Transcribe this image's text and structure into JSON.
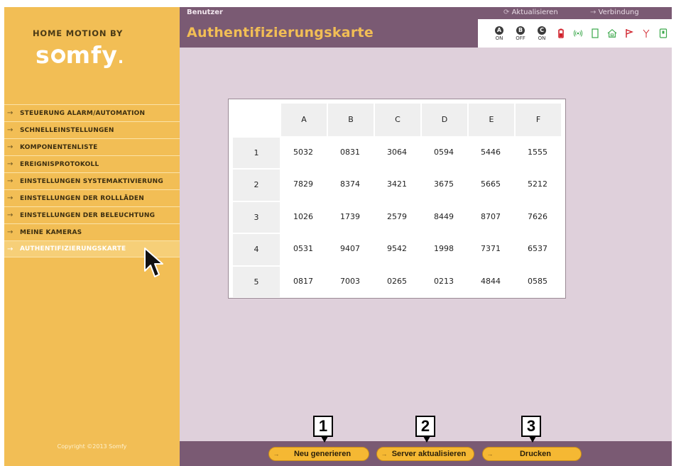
{
  "brand": {
    "top_text": "HOME MOTION BY",
    "logo_text": "somfy."
  },
  "sidebar": {
    "items": [
      {
        "label": "STEUERUNG ALARM/AUTOMATION"
      },
      {
        "label": "SCHNELLEINSTELLUNGEN"
      },
      {
        "label": "KOMPONENTENLISTE"
      },
      {
        "label": "EREIGNISPROTOKOLL"
      },
      {
        "label": "EINSTELLUNGEN SYSTEMAKTIVIERUNG"
      },
      {
        "label": "EINSTELLUNGEN DER ROLLLÄDEN"
      },
      {
        "label": "EINSTELLUNGEN DER BELEUCHTUNG"
      },
      {
        "label": "MEINE KAMERAS"
      },
      {
        "label": "AUTHENTIFIZIERUNGSKARTE",
        "active": true
      }
    ],
    "copyright": "Copyright ©2013 Somfy"
  },
  "header": {
    "user_label": "Benutzer",
    "refresh_link": "Aktualisieren",
    "connection_link": "Verbindung",
    "title": "Authentifizierungskarte",
    "modes": [
      {
        "letter": "A",
        "state": "ON"
      },
      {
        "letter": "B",
        "state": "OFF"
      },
      {
        "letter": "C",
        "state": "ON"
      }
    ],
    "status_icons": [
      "battery-icon",
      "radio-signal-icon",
      "door-icon",
      "home-icon",
      "flag-icon",
      "antenna-icon",
      "device-icon"
    ]
  },
  "auth_card": {
    "columns": [
      "A",
      "B",
      "C",
      "D",
      "E",
      "F"
    ],
    "rows": [
      {
        "label": "1",
        "values": [
          "5032",
          "0831",
          "3064",
          "0594",
          "5446",
          "1555"
        ]
      },
      {
        "label": "2",
        "values": [
          "7829",
          "8374",
          "3421",
          "3675",
          "5665",
          "5212"
        ]
      },
      {
        "label": "3",
        "values": [
          "1026",
          "1739",
          "2579",
          "8449",
          "8707",
          "7626"
        ]
      },
      {
        "label": "4",
        "values": [
          "0531",
          "9407",
          "9542",
          "1998",
          "7371",
          "6537"
        ]
      },
      {
        "label": "5",
        "values": [
          "0817",
          "7003",
          "0265",
          "0213",
          "4844",
          "0585"
        ]
      }
    ]
  },
  "footer": {
    "buttons": [
      {
        "label": "Neu generieren"
      },
      {
        "label": "Server aktualisieren"
      },
      {
        "label": "Drucken"
      }
    ]
  },
  "callouts": [
    "1",
    "2",
    "3"
  ],
  "colors": {
    "sidebar": "#f2be55",
    "header": "#7a5a73",
    "content_bg": "#dfd0db",
    "title_text": "#f2be55",
    "button": "#f5b833"
  }
}
